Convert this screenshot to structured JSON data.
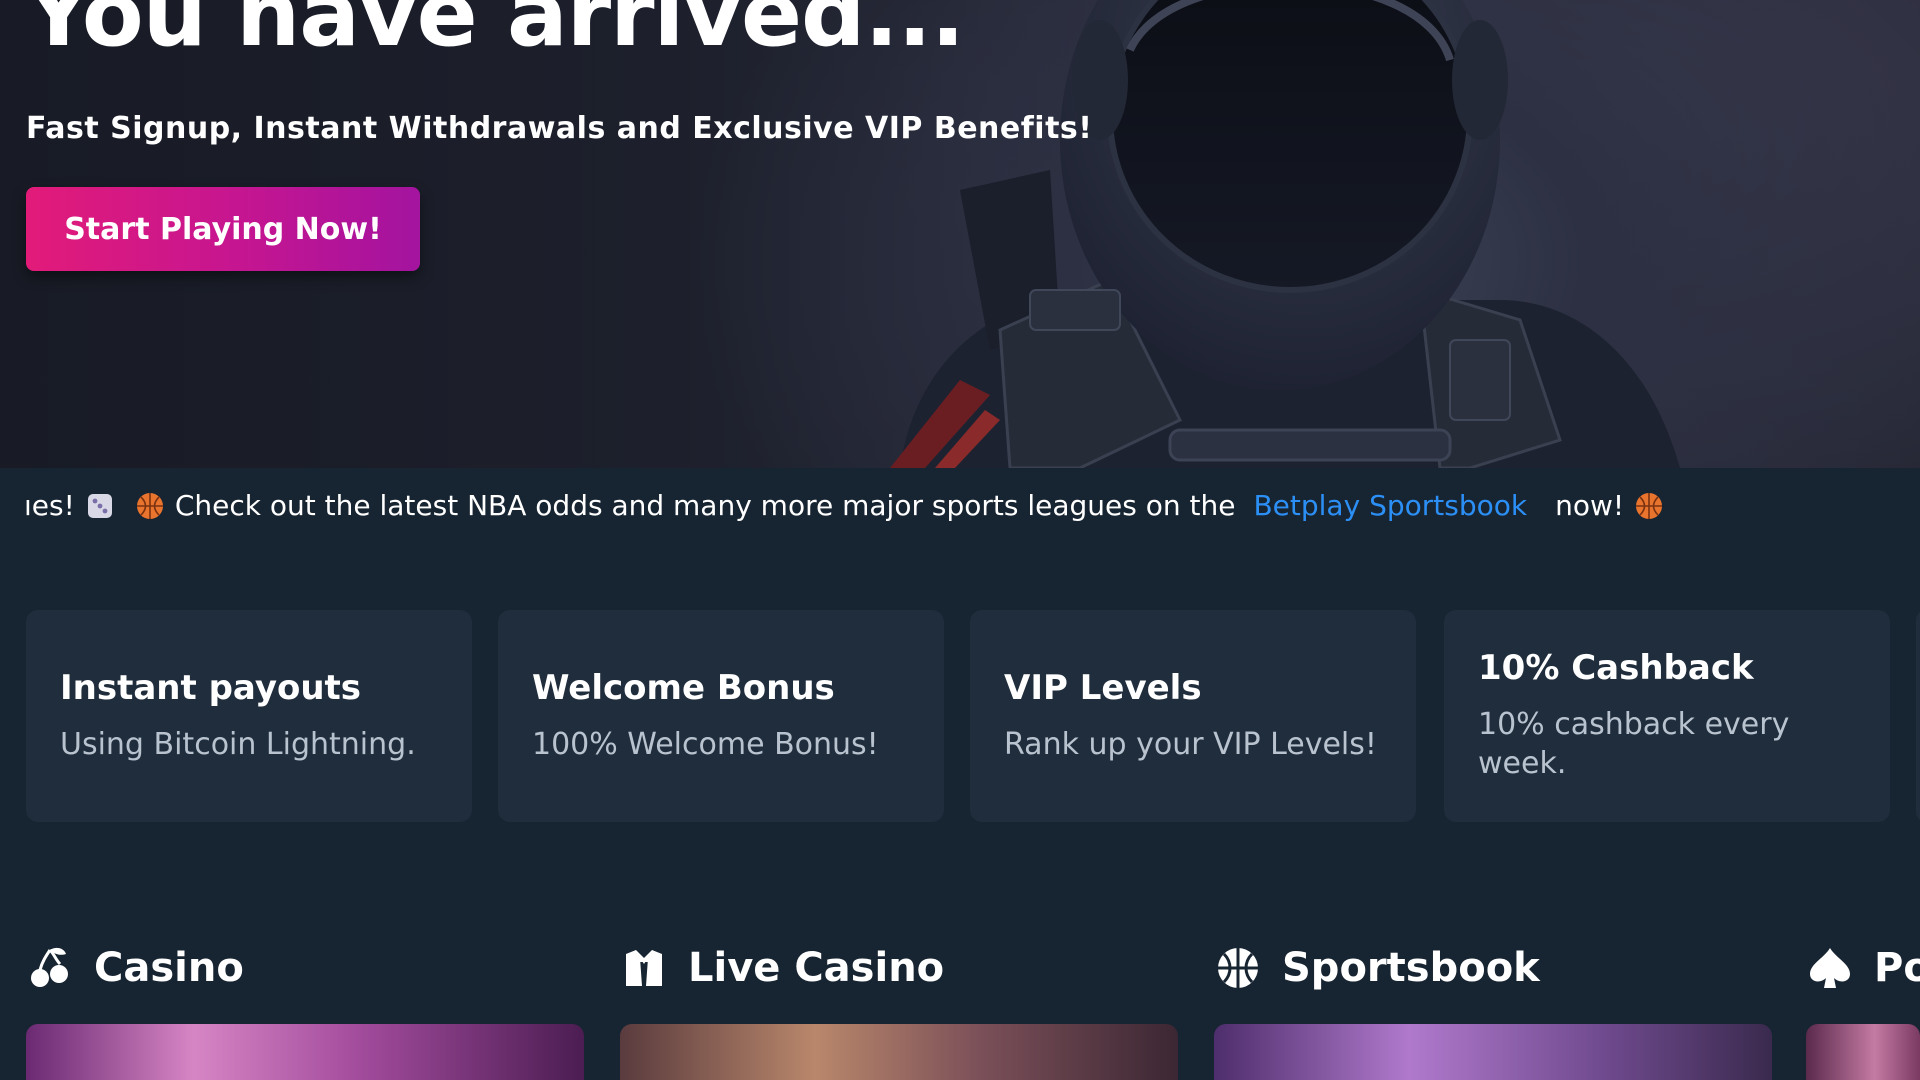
{
  "hero": {
    "title": "You have arrived...",
    "subtitle": "Fast Signup, Instant Withdrawals and Exclusive VIP Benefits!",
    "cta_label": "Start Playing Now!"
  },
  "ticker": {
    "lead_fragment": "ıes!",
    "lead_icon": "dice-icon",
    "icon": "basketball-icon",
    "message": "Check out the latest NBA odds and many more major sports leagues on the",
    "link_text": "Betplay Sportsbook",
    "tail": "now!",
    "link_color": "#2c8ff5"
  },
  "features": [
    {
      "title": "Instant payouts",
      "desc": "Using Bitcoin Lightning."
    },
    {
      "title": "Welcome Bonus",
      "desc": "100% Welcome Bonus!"
    },
    {
      "title": "VIP Levels",
      "desc": "Rank up your VIP Levels!"
    },
    {
      "title": "10% Cashback",
      "desc": "10% cashback every week."
    }
  ],
  "categories": [
    {
      "label": "Casino",
      "icon": "cherries-icon"
    },
    {
      "label": "Live Casino",
      "icon": "dealer-icon"
    },
    {
      "label": "Sportsbook",
      "icon": "ball-icon"
    },
    {
      "label": "Po",
      "icon": "spade-icon"
    }
  ],
  "colors": {
    "page_bg": "#172431",
    "card_bg": "#1f2d3c",
    "cta_gradient_start": "#e21b79",
    "cta_gradient_end": "#a3149f"
  }
}
